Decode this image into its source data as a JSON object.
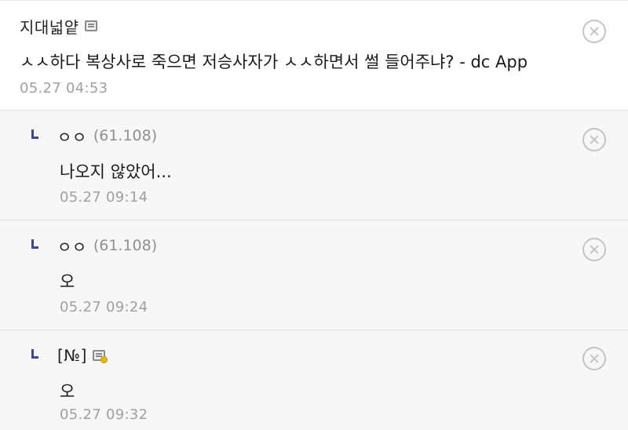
{
  "comments": [
    {
      "nickname": "지대넓얕",
      "ip": "",
      "has_memo_icon": true,
      "text": "ㅅㅅ하다 복상사로 죽으면 저승사자가 ㅅㅅ하면서 썰 들어주냐? - dc App",
      "time": "05.27 04:53"
    }
  ],
  "replies": [
    {
      "nickname": "ㅇㅇ",
      "ip": "(61.108)",
      "text": "나오지 않았어...",
      "time": "05.27 09:14"
    },
    {
      "nickname": "ㅇㅇ",
      "ip": "(61.108)",
      "text": "오",
      "time": "05.27 09:24"
    },
    {
      "nickname": "[№]",
      "ip": "",
      "has_memo_icon": true,
      "text": "오",
      "time": "05.27 09:32"
    }
  ],
  "icons": {
    "reply_marker": "reply-arrow-icon",
    "memo": "memo-icon",
    "delete": "delete-circle-x-icon"
  },
  "colors": {
    "reply_marker": "#3b4a8a",
    "reply_bg": "#f7f7f7",
    "timestamp": "#a0a0a0",
    "ip": "#8f8f8f"
  }
}
